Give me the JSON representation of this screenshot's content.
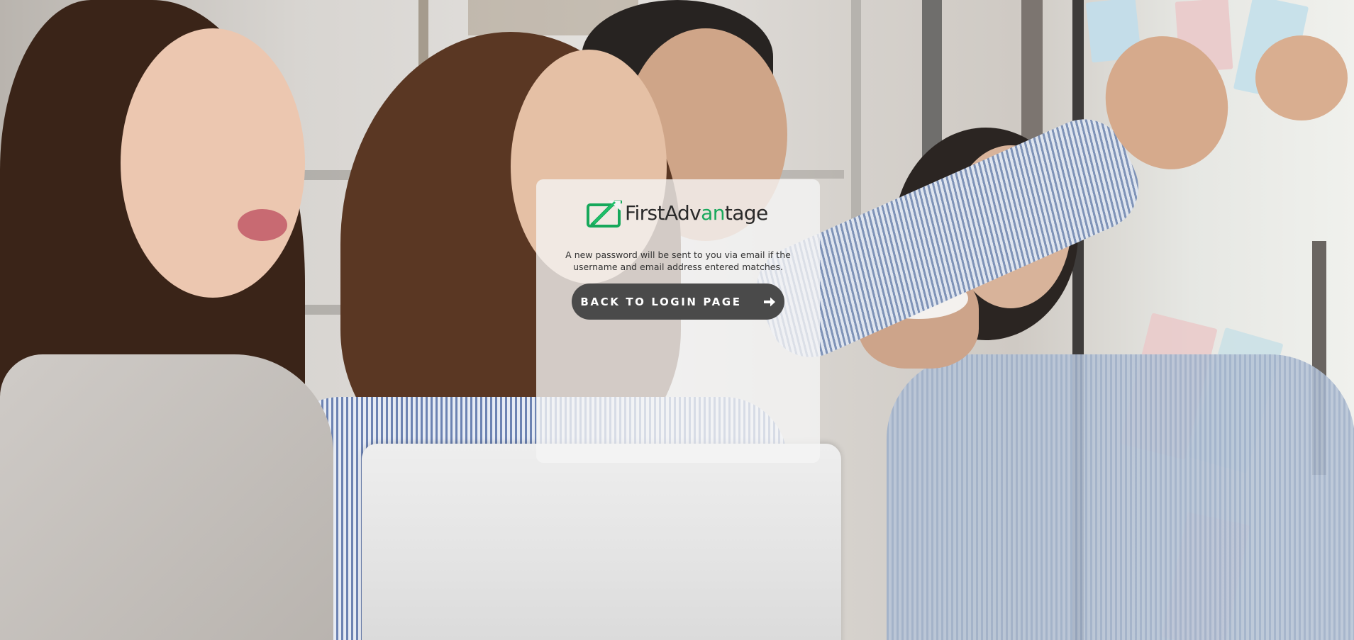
{
  "brand": {
    "name_part1": "First",
    "name_part2": "Adv",
    "name_accent": "an",
    "name_part3": "tage",
    "logo_icon": "first-advantage-logo-mark",
    "accent_color": "#17a85b",
    "text_color": "#2a2a2a"
  },
  "message": {
    "line1": "A new password will be sent to you via email if the",
    "line2": "username and email address entered matches."
  },
  "back_button": {
    "label": "BACK TO LOGIN PAGE",
    "icon": "arrow-right-icon",
    "color": "#4a4a4a"
  },
  "background": {
    "description_icon": "office-team-photo"
  }
}
